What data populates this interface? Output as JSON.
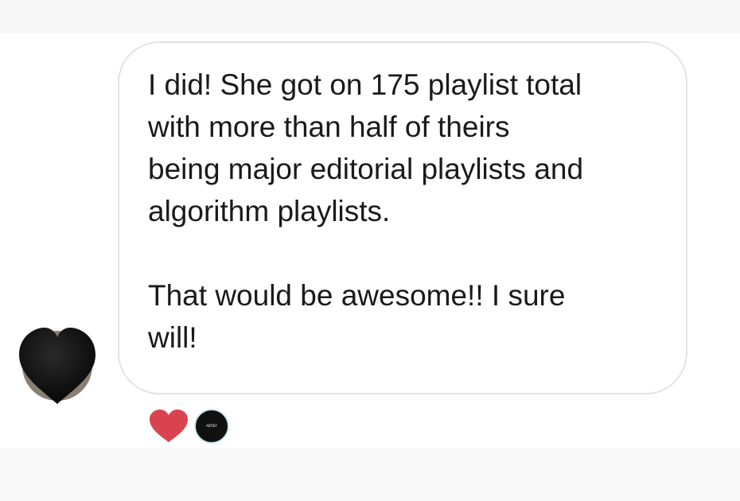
{
  "conversation": {
    "message": {
      "text": "I did! She got on 175 playlist total\nwith more than half of theirs\nbeing major editorial playlists and\nalgorithm playlists.\n\nThat would be awesome!! I sure\nwill!"
    },
    "sender_avatar": {
      "icon": "black-heart-icon",
      "color": "#121212"
    },
    "reactions": [
      {
        "icon": "heart-icon",
        "color": "#d9434f"
      }
    ],
    "reactor_avatar": {
      "label": "ARTIST",
      "background": "#111111",
      "ring_color": "#cfe8ee"
    }
  },
  "colors": {
    "bubble_border": "#e3e3e3",
    "text": "#1a1a1a",
    "background": "#ffffff"
  }
}
